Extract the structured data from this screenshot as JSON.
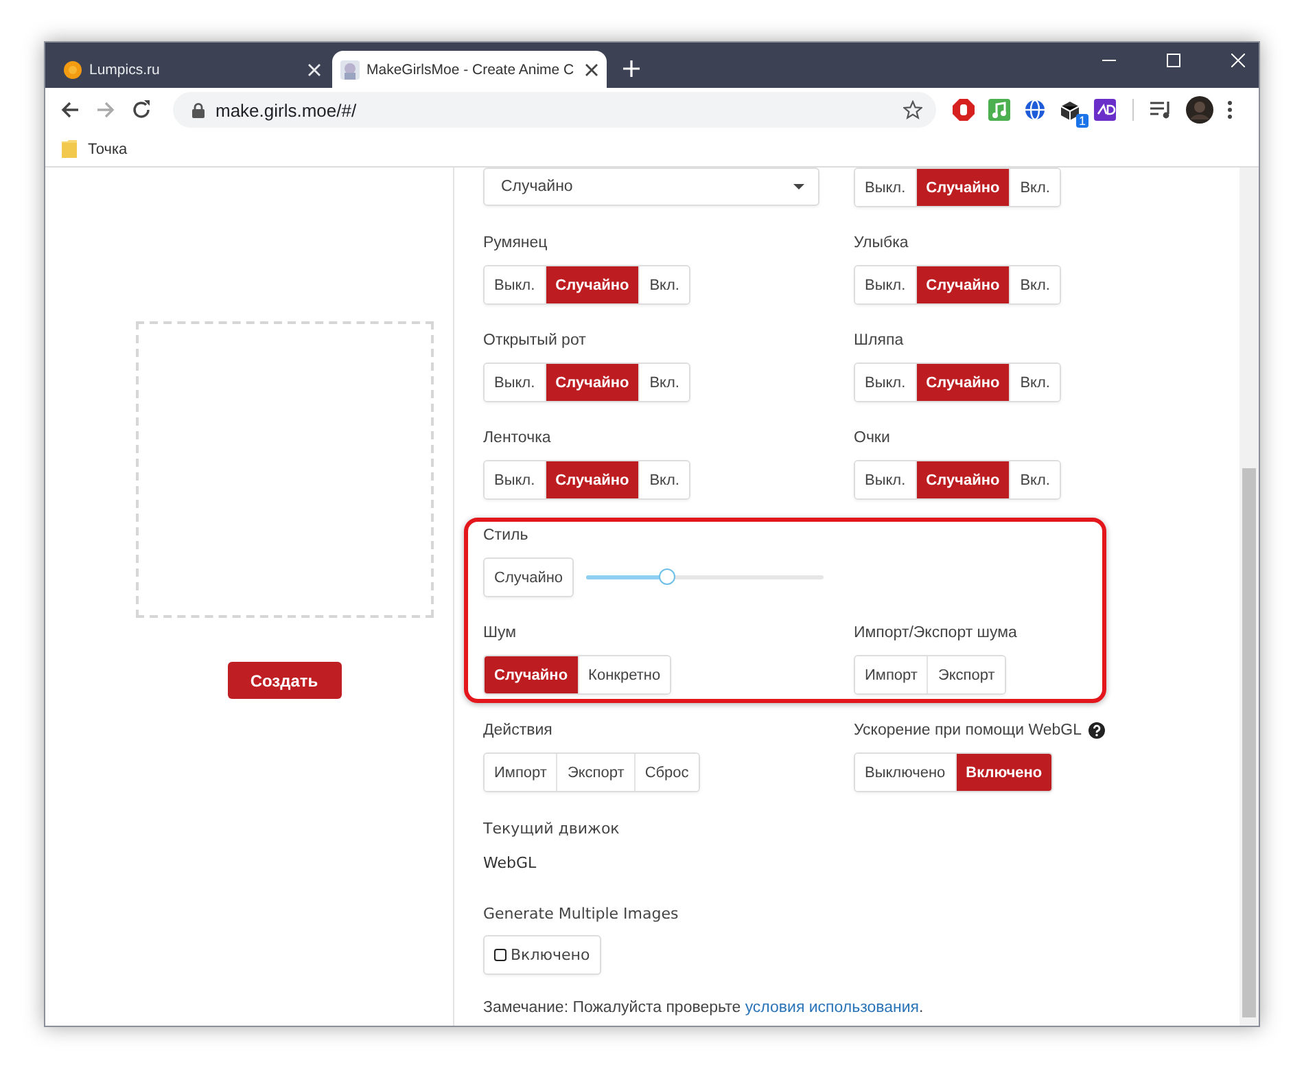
{
  "browser": {
    "tabs": [
      {
        "title": "Lumpics.ru",
        "selected": false
      },
      {
        "title": "MakeGirlsMoe - Create Anime C",
        "selected": true
      }
    ],
    "address": "make.girls.moe/#/",
    "extension_badge": "1",
    "bookmarks": [
      "Точка"
    ]
  },
  "generator": {
    "create_button": "Создать"
  },
  "rows": [
    {
      "highlighted": false,
      "cells": [
        {
          "kind": "dropdown",
          "value": "Случайно"
        },
        {
          "kind": "segmented",
          "options": [
            {
              "label": "Выкл.",
              "selected": false
            },
            {
              "label": "Случайно",
              "selected": true
            },
            {
              "label": "Вкл.",
              "selected": false
            }
          ]
        }
      ]
    },
    {
      "highlighted": false,
      "cells": [
        {
          "kind": "segmented",
          "label": "Румянец",
          "options": [
            {
              "label": "Выкл.",
              "selected": false
            },
            {
              "label": "Случайно",
              "selected": true
            },
            {
              "label": "Вкл.",
              "selected": false
            }
          ]
        },
        {
          "kind": "segmented",
          "label": "Улыбка",
          "options": [
            {
              "label": "Выкл.",
              "selected": false
            },
            {
              "label": "Случайно",
              "selected": true
            },
            {
              "label": "Вкл.",
              "selected": false
            }
          ]
        }
      ]
    },
    {
      "highlighted": false,
      "cells": [
        {
          "kind": "segmented",
          "label": "Открытый рот",
          "options": [
            {
              "label": "Выкл.",
              "selected": false
            },
            {
              "label": "Случайно",
              "selected": true
            },
            {
              "label": "Вкл.",
              "selected": false
            }
          ]
        },
        {
          "kind": "segmented",
          "label": "Шляпа",
          "options": [
            {
              "label": "Выкл.",
              "selected": false
            },
            {
              "label": "Случайно",
              "selected": true
            },
            {
              "label": "Вкл.",
              "selected": false
            }
          ]
        }
      ]
    },
    {
      "highlighted": false,
      "cells": [
        {
          "kind": "segmented",
          "label": "Ленточка",
          "options": [
            {
              "label": "Выкл.",
              "selected": false
            },
            {
              "label": "Случайно",
              "selected": true
            },
            {
              "label": "Вкл.",
              "selected": false
            }
          ]
        },
        {
          "kind": "segmented",
          "label": "Очки",
          "options": [
            {
              "label": "Выкл.",
              "selected": false
            },
            {
              "label": "Случайно",
              "selected": true
            },
            {
              "label": "Вкл.",
              "selected": false
            }
          ]
        }
      ]
    },
    {
      "highlighted": true,
      "cells": [
        {
          "kind": "random_slider",
          "label": "Стиль",
          "button": {
            "label": "Случайно",
            "selected": false
          },
          "level": 0.34
        }
      ]
    },
    {
      "highlighted": true,
      "cells": [
        {
          "kind": "segmented",
          "label": "Шум",
          "options": [
            {
              "label": "Случайно",
              "selected": true
            },
            {
              "label": "Конкретно",
              "selected": false
            }
          ]
        },
        {
          "kind": "segmented",
          "label": "Импорт/Экспорт шума",
          "options": [
            {
              "label": "Импорт",
              "selected": false
            },
            {
              "label": "Экспорт",
              "selected": false
            }
          ]
        }
      ]
    },
    {
      "highlighted": false,
      "cells": [
        {
          "kind": "segmented",
          "label": "Действия",
          "options": [
            {
              "label": "Импорт",
              "selected": false
            },
            {
              "label": "Экспорт",
              "selected": false
            },
            {
              "label": "Сброс",
              "selected": false
            }
          ]
        },
        {
          "kind": "segmented",
          "label": "Ускорение при помощи WebGL",
          "help_icon": true,
          "options": [
            {
              "label": "Выключено",
              "selected": false
            },
            {
              "label": "Включено",
              "selected": true
            }
          ]
        }
      ]
    },
    {
      "highlighted": false,
      "cells": [
        {
          "kind": "text",
          "label": "Текущий движок",
          "value": "WebGL"
        }
      ]
    },
    {
      "highlighted": false,
      "cells": [
        {
          "kind": "checkbox_button",
          "label": "Generate Multiple Images",
          "button": {
            "label": "Включено",
            "checked": false
          }
        }
      ]
    }
  ],
  "note": {
    "text": "Замечание: Пожалуйста проверьте ",
    "link": "условия использования",
    "end": "."
  }
}
